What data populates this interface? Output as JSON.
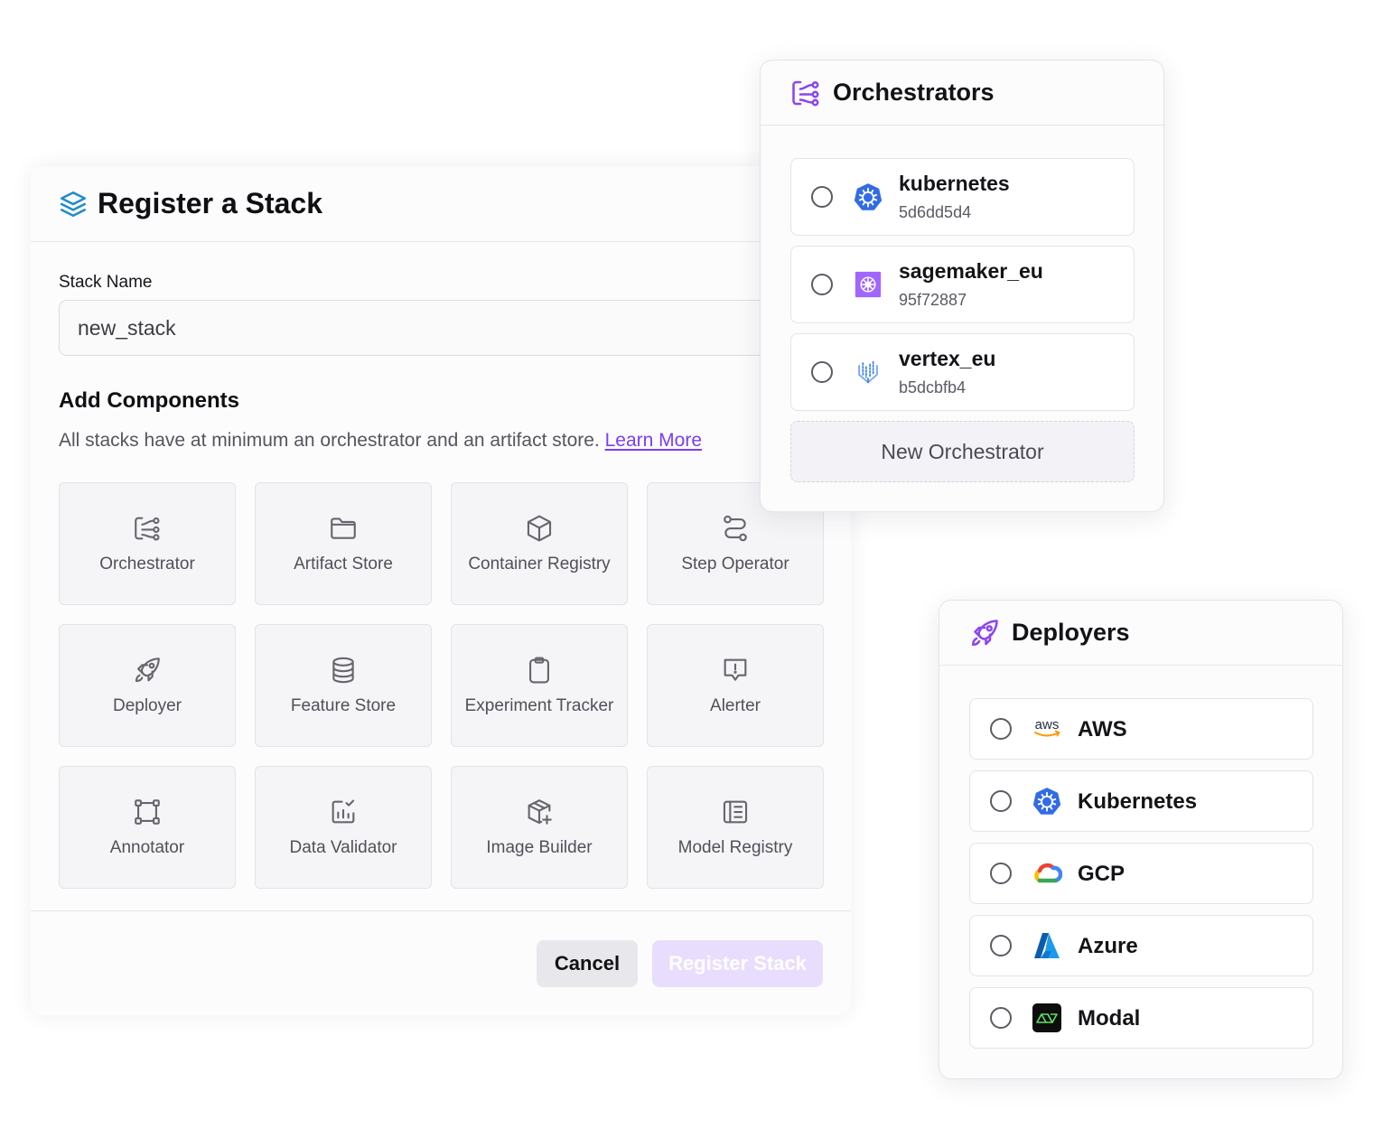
{
  "register": {
    "title": "Register a Stack",
    "stack_name_label": "Stack Name",
    "stack_name_value": "new_stack",
    "components_title": "Add Components",
    "components_desc": "All stacks have at minimum an orchestrator and an artifact store.",
    "learn_more": "Learn More",
    "components": [
      {
        "label": "Orchestrator",
        "icon": "orchestrator-icon"
      },
      {
        "label": "Artifact Store",
        "icon": "folder-icon"
      },
      {
        "label": "Container Registry",
        "icon": "box-icon"
      },
      {
        "label": "Step Operator",
        "icon": "route-icon"
      },
      {
        "label": "Deployer",
        "icon": "rocket-icon"
      },
      {
        "label": "Feature Store",
        "icon": "database-icon"
      },
      {
        "label": "Experiment Tracker",
        "icon": "clipboard-icon"
      },
      {
        "label": "Alerter",
        "icon": "alert-message-icon"
      },
      {
        "label": "Annotator",
        "icon": "annotation-frame-icon"
      },
      {
        "label": "Data Validator",
        "icon": "chart-check-icon"
      },
      {
        "label": "Image Builder",
        "icon": "package-plus-icon"
      },
      {
        "label": "Model Registry",
        "icon": "registry-book-icon"
      }
    ],
    "cancel_label": "Cancel",
    "register_label": "Register Stack"
  },
  "orchestrators": {
    "title": "Orchestrators",
    "items": [
      {
        "name": "kubernetes",
        "id": "5d6dd5d4",
        "logo": "kubernetes-logo-icon"
      },
      {
        "name": "sagemaker_eu",
        "id": "95f72887",
        "logo": "sagemaker-logo-icon"
      },
      {
        "name": "vertex_eu",
        "id": "b5dcbfb4",
        "logo": "vertex-logo-icon"
      }
    ],
    "new_label": "New Orchestrator"
  },
  "deployers": {
    "title": "Deployers",
    "items": [
      {
        "name": "AWS",
        "logo": "aws-logo-icon",
        "logo_text": "aws"
      },
      {
        "name": "Kubernetes",
        "logo": "kubernetes-logo-icon"
      },
      {
        "name": "GCP",
        "logo": "gcp-logo-icon"
      },
      {
        "name": "Azure",
        "logo": "azure-logo-icon"
      },
      {
        "name": "Modal",
        "logo": "modal-logo-icon"
      }
    ]
  },
  "colors": {
    "accent": "#7a3ff2",
    "register_disabled_bg": "#e9ddfd",
    "tile_bg": "#f5f5f7",
    "kubernetes_blue": "#326ce5",
    "sagemaker_purple": "#a166ff"
  }
}
